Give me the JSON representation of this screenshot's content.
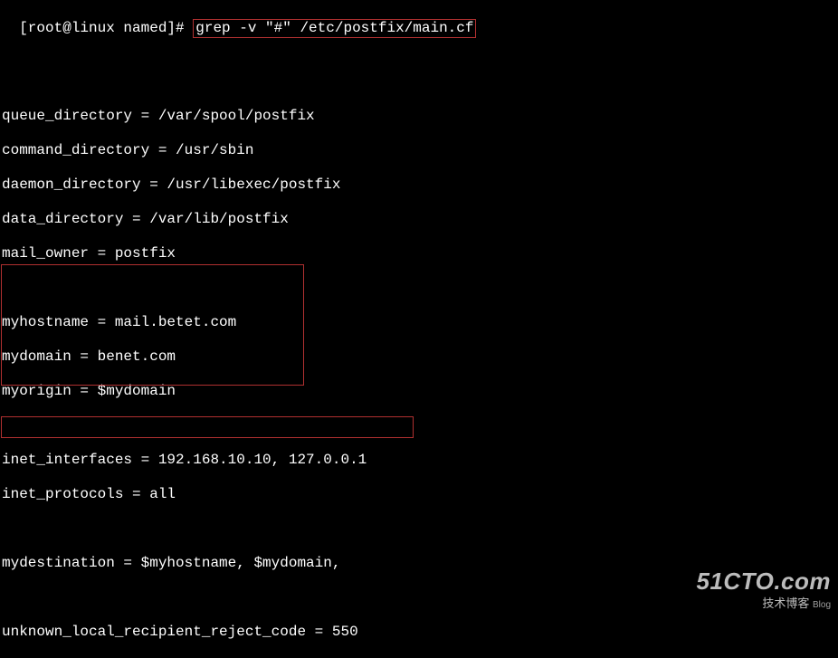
{
  "prompt": "[root@linux named]# ",
  "command": "grep -v \"#\" /etc/postfix/main.cf",
  "output_lines": [
    "",
    "",
    "",
    "queue_directory = /var/spool/postfix",
    "",
    "command_directory = /usr/sbin",
    "",
    "daemon_directory = /usr/libexec/postfix",
    "",
    "data_directory = /var/lib/postfix",
    "",
    "mail_owner = postfix",
    "",
    "",
    "",
    "myhostname = mail.betet.com",
    "",
    "mydomain = benet.com",
    "",
    "myorigin = $mydomain",
    "",
    "",
    "",
    "inet_interfaces = 192.168.10.10, 127.0.0.1",
    "",
    "inet_protocols = all",
    "",
    "",
    "",
    "mydestination = $myhostname, $mydomain,",
    "",
    "",
    "",
    "unknown_local_recipient_reject_code = 550"
  ],
  "watermark": {
    "brand": "51CTO.com",
    "sub": "技术博客",
    "blog": "Blog"
  }
}
